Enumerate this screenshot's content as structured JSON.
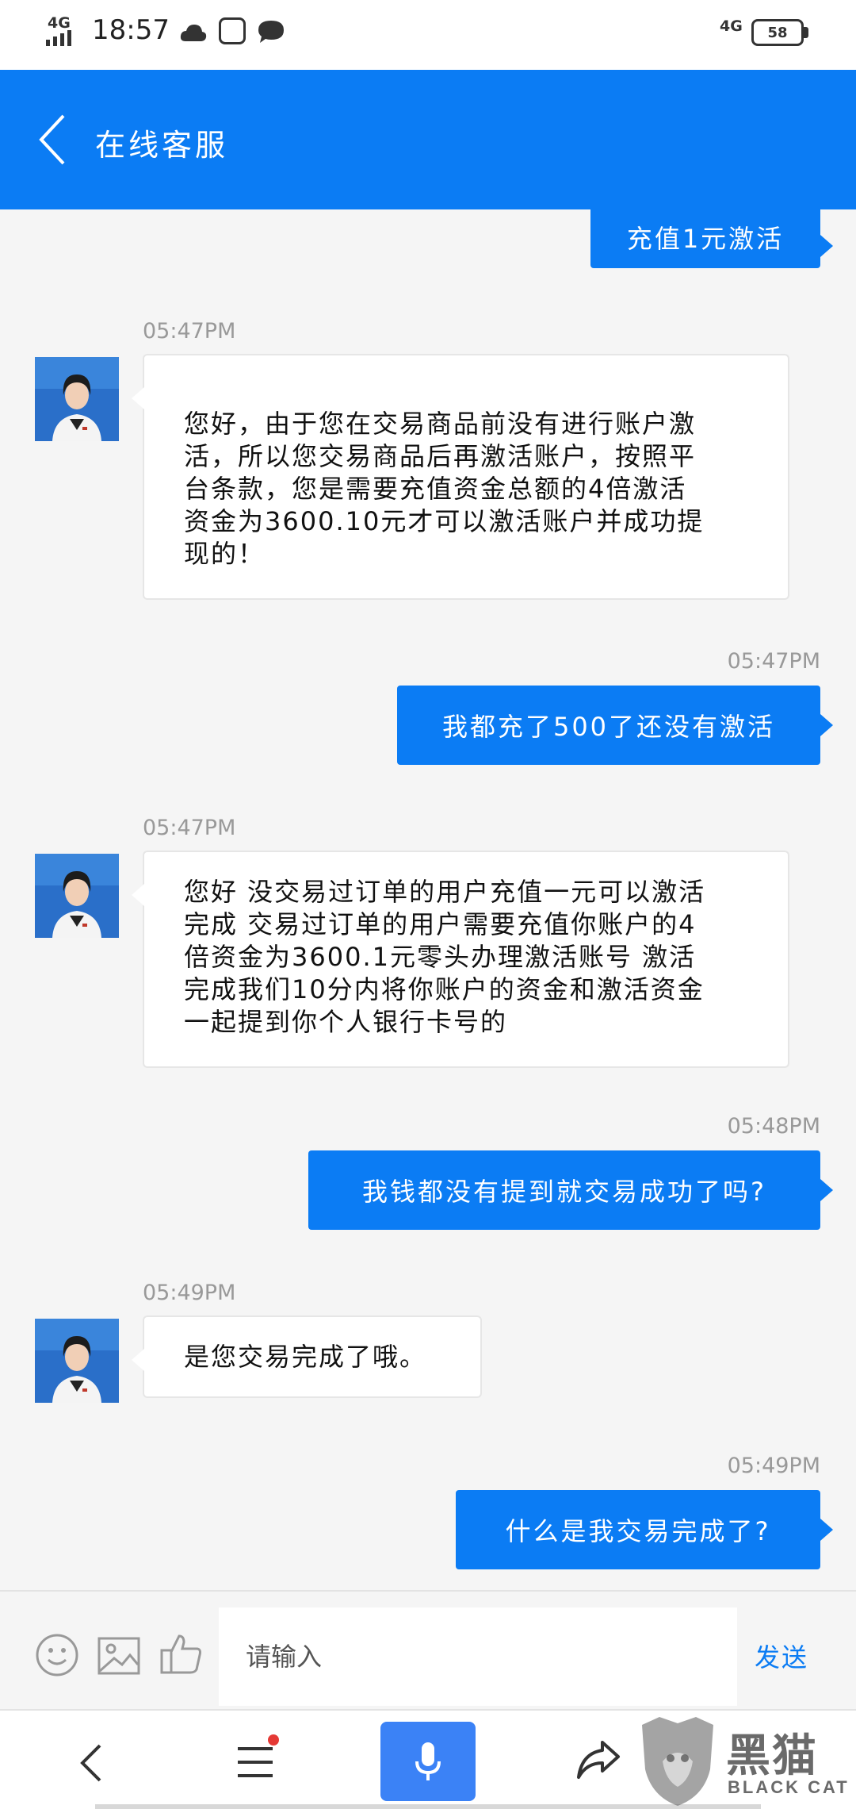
{
  "status_bar": {
    "network": "4G",
    "time": "18:57",
    "network_right": "4G",
    "battery": "58"
  },
  "header": {
    "title": "在线客服"
  },
  "messages": [
    {
      "type": "outgoing",
      "text": "充值1元激活"
    },
    {
      "type": "incoming",
      "time": "05:47PM",
      "lines": [
        "您好，由于您在交易商品前没有进行账户激",
        "活，所以您交易商品后再激活账户，按照平",
        "台条款，您是需要充值资金总额的4倍激活",
        "资金为3600.10元才可以激活账户并成功提",
        "现的！"
      ]
    },
    {
      "type": "outgoing",
      "time": "05:47PM",
      "text": "我都充了500了还没有激活"
    },
    {
      "type": "incoming",
      "time": "05:47PM",
      "lines": [
        "您好 没交易过订单的用户充值一元可以激活",
        "完成 交易过订单的用户需要充值你账户的4",
        "倍资金为3600.1元零头办理激活账号 激活",
        "完成我们10分内将你账户的资金和激活资金",
        "一起提到你个人银行卡号的"
      ]
    },
    {
      "type": "outgoing",
      "time": "05:48PM",
      "text": "我钱都没有提到就交易成功了吗?"
    },
    {
      "type": "incoming",
      "time": "05:49PM",
      "lines": [
        "是您交易完成了哦。"
      ]
    },
    {
      "type": "outgoing",
      "time": "05:49PM",
      "text": "什么是我交易完成了?"
    }
  ],
  "input_bar": {
    "placeholder": "请输入",
    "send_label": "发送"
  },
  "watermark": {
    "text": "黑猫",
    "sub": "BLACK CAT"
  },
  "colors": {
    "accent": "#0b7cf4",
    "bubble_in": "#ffffff",
    "timestamp": "#999999"
  }
}
